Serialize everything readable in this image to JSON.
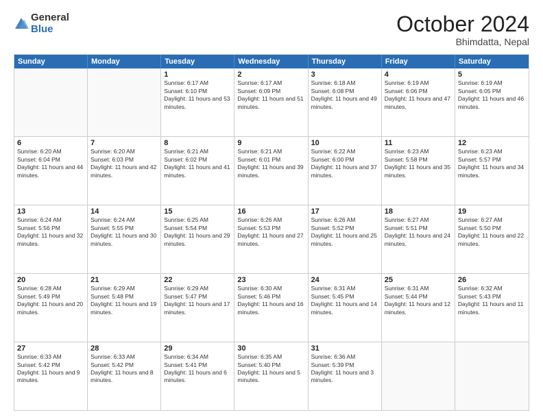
{
  "logo": {
    "general": "General",
    "blue": "Blue"
  },
  "title": "October 2024",
  "location": "Bhimdatta, Nepal",
  "header_days": [
    "Sunday",
    "Monday",
    "Tuesday",
    "Wednesday",
    "Thursday",
    "Friday",
    "Saturday"
  ],
  "weeks": [
    [
      {
        "day": "",
        "sunrise": "",
        "sunset": "",
        "daylight": ""
      },
      {
        "day": "",
        "sunrise": "",
        "sunset": "",
        "daylight": ""
      },
      {
        "day": "1",
        "sunrise": "Sunrise: 6:17 AM",
        "sunset": "Sunset: 6:10 PM",
        "daylight": "Daylight: 11 hours and 53 minutes."
      },
      {
        "day": "2",
        "sunrise": "Sunrise: 6:17 AM",
        "sunset": "Sunset: 6:09 PM",
        "daylight": "Daylight: 11 hours and 51 minutes."
      },
      {
        "day": "3",
        "sunrise": "Sunrise: 6:18 AM",
        "sunset": "Sunset: 6:08 PM",
        "daylight": "Daylight: 11 hours and 49 minutes."
      },
      {
        "day": "4",
        "sunrise": "Sunrise: 6:19 AM",
        "sunset": "Sunset: 6:06 PM",
        "daylight": "Daylight: 11 hours and 47 minutes."
      },
      {
        "day": "5",
        "sunrise": "Sunrise: 6:19 AM",
        "sunset": "Sunset: 6:05 PM",
        "daylight": "Daylight: 11 hours and 46 minutes."
      }
    ],
    [
      {
        "day": "6",
        "sunrise": "Sunrise: 6:20 AM",
        "sunset": "Sunset: 6:04 PM",
        "daylight": "Daylight: 11 hours and 44 minutes."
      },
      {
        "day": "7",
        "sunrise": "Sunrise: 6:20 AM",
        "sunset": "Sunset: 6:03 PM",
        "daylight": "Daylight: 11 hours and 42 minutes."
      },
      {
        "day": "8",
        "sunrise": "Sunrise: 6:21 AM",
        "sunset": "Sunset: 6:02 PM",
        "daylight": "Daylight: 11 hours and 41 minutes."
      },
      {
        "day": "9",
        "sunrise": "Sunrise: 6:21 AM",
        "sunset": "Sunset: 6:01 PM",
        "daylight": "Daylight: 11 hours and 39 minutes."
      },
      {
        "day": "10",
        "sunrise": "Sunrise: 6:22 AM",
        "sunset": "Sunset: 6:00 PM",
        "daylight": "Daylight: 11 hours and 37 minutes."
      },
      {
        "day": "11",
        "sunrise": "Sunrise: 6:23 AM",
        "sunset": "Sunset: 5:58 PM",
        "daylight": "Daylight: 11 hours and 35 minutes."
      },
      {
        "day": "12",
        "sunrise": "Sunrise: 6:23 AM",
        "sunset": "Sunset: 5:57 PM",
        "daylight": "Daylight: 11 hours and 34 minutes."
      }
    ],
    [
      {
        "day": "13",
        "sunrise": "Sunrise: 6:24 AM",
        "sunset": "Sunset: 5:56 PM",
        "daylight": "Daylight: 11 hours and 32 minutes."
      },
      {
        "day": "14",
        "sunrise": "Sunrise: 6:24 AM",
        "sunset": "Sunset: 5:55 PM",
        "daylight": "Daylight: 11 hours and 30 minutes."
      },
      {
        "day": "15",
        "sunrise": "Sunrise: 6:25 AM",
        "sunset": "Sunset: 5:54 PM",
        "daylight": "Daylight: 11 hours and 29 minutes."
      },
      {
        "day": "16",
        "sunrise": "Sunrise: 6:26 AM",
        "sunset": "Sunset: 5:53 PM",
        "daylight": "Daylight: 11 hours and 27 minutes."
      },
      {
        "day": "17",
        "sunrise": "Sunrise: 6:26 AM",
        "sunset": "Sunset: 5:52 PM",
        "daylight": "Daylight: 11 hours and 25 minutes."
      },
      {
        "day": "18",
        "sunrise": "Sunrise: 6:27 AM",
        "sunset": "Sunset: 5:51 PM",
        "daylight": "Daylight: 11 hours and 24 minutes."
      },
      {
        "day": "19",
        "sunrise": "Sunrise: 6:27 AM",
        "sunset": "Sunset: 5:50 PM",
        "daylight": "Daylight: 11 hours and 22 minutes."
      }
    ],
    [
      {
        "day": "20",
        "sunrise": "Sunrise: 6:28 AM",
        "sunset": "Sunset: 5:49 PM",
        "daylight": "Daylight: 11 hours and 20 minutes."
      },
      {
        "day": "21",
        "sunrise": "Sunrise: 6:29 AM",
        "sunset": "Sunset: 5:48 PM",
        "daylight": "Daylight: 11 hours and 19 minutes."
      },
      {
        "day": "22",
        "sunrise": "Sunrise: 6:29 AM",
        "sunset": "Sunset: 5:47 PM",
        "daylight": "Daylight: 11 hours and 17 minutes."
      },
      {
        "day": "23",
        "sunrise": "Sunrise: 6:30 AM",
        "sunset": "Sunset: 5:46 PM",
        "daylight": "Daylight: 11 hours and 16 minutes."
      },
      {
        "day": "24",
        "sunrise": "Sunrise: 6:31 AM",
        "sunset": "Sunset: 5:45 PM",
        "daylight": "Daylight: 11 hours and 14 minutes."
      },
      {
        "day": "25",
        "sunrise": "Sunrise: 6:31 AM",
        "sunset": "Sunset: 5:44 PM",
        "daylight": "Daylight: 11 hours and 12 minutes."
      },
      {
        "day": "26",
        "sunrise": "Sunrise: 6:32 AM",
        "sunset": "Sunset: 5:43 PM",
        "daylight": "Daylight: 11 hours and 11 minutes."
      }
    ],
    [
      {
        "day": "27",
        "sunrise": "Sunrise: 6:33 AM",
        "sunset": "Sunset: 5:42 PM",
        "daylight": "Daylight: 11 hours and 9 minutes."
      },
      {
        "day": "28",
        "sunrise": "Sunrise: 6:33 AM",
        "sunset": "Sunset: 5:42 PM",
        "daylight": "Daylight: 11 hours and 8 minutes."
      },
      {
        "day": "29",
        "sunrise": "Sunrise: 6:34 AM",
        "sunset": "Sunset: 5:41 PM",
        "daylight": "Daylight: 11 hours and 6 minutes."
      },
      {
        "day": "30",
        "sunrise": "Sunrise: 6:35 AM",
        "sunset": "Sunset: 5:40 PM",
        "daylight": "Daylight: 11 hours and 5 minutes."
      },
      {
        "day": "31",
        "sunrise": "Sunrise: 6:36 AM",
        "sunset": "Sunset: 5:39 PM",
        "daylight": "Daylight: 11 hours and 3 minutes."
      },
      {
        "day": "",
        "sunrise": "",
        "sunset": "",
        "daylight": ""
      },
      {
        "day": "",
        "sunrise": "",
        "sunset": "",
        "daylight": ""
      }
    ]
  ]
}
